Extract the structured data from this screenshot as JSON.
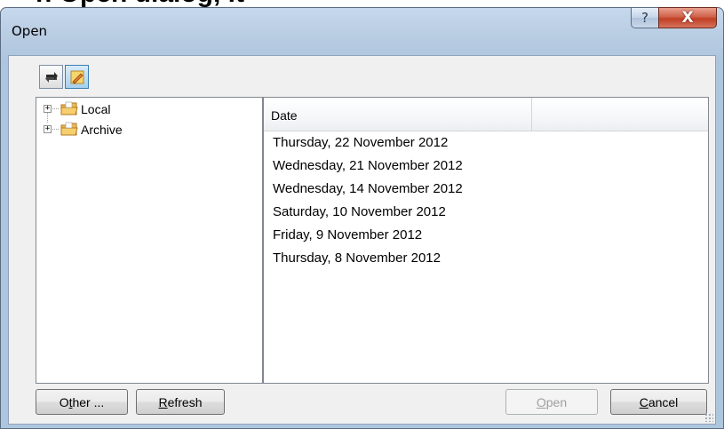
{
  "window": {
    "title": "Open",
    "help_glyph": "?",
    "close_glyph": "X",
    "cropped_heading": "n Open dialog, it"
  },
  "toolbar": {
    "buttons": [
      {
        "icon": "refresh-arrows-icon"
      },
      {
        "icon": "edit-pencil-icon"
      }
    ]
  },
  "tree": {
    "items": [
      {
        "label": "Local",
        "expander": "+",
        "icon": "folder-icon"
      },
      {
        "label": "Archive",
        "expander": "+",
        "icon": "folder-icon"
      }
    ]
  },
  "list": {
    "column_header": "Date",
    "rows": [
      "Thursday, 22 November 2012",
      "Wednesday, 21 November 2012",
      "Wednesday, 14 November 2012",
      "Saturday, 10 November 2012",
      "Friday, 9 November 2012",
      "Thursday, 8 November 2012"
    ]
  },
  "buttons": {
    "other": {
      "prefix": "O",
      "mnemonic": "t",
      "suffix": "her ..."
    },
    "refresh": {
      "mnemonic": "R",
      "suffix": "efresh"
    },
    "open": {
      "mnemonic": "O",
      "suffix": "pen",
      "enabled": false
    },
    "cancel": {
      "mnemonic": "C",
      "suffix": "ancel"
    }
  },
  "colors": {
    "close_button": "#c13e24",
    "folder": "#e8a640",
    "disabled_text": "#a0a0a0"
  }
}
